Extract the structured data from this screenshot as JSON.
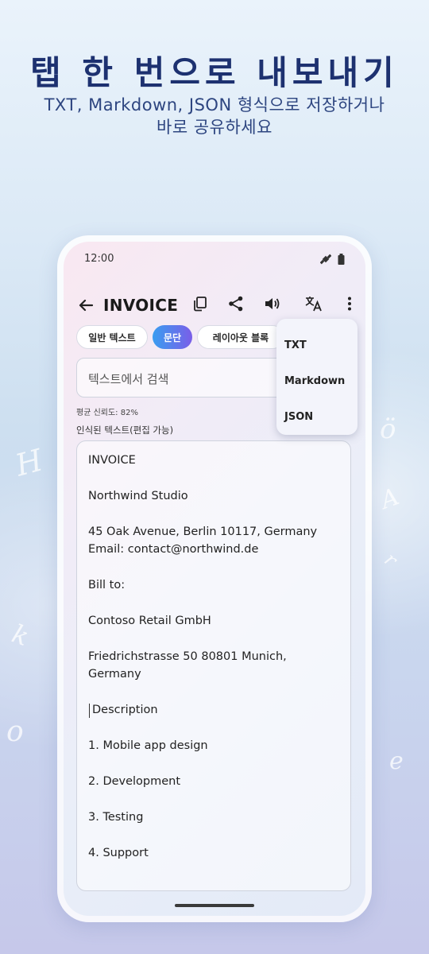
{
  "promo": {
    "headline": "탭 한 번으로 내보내기",
    "subline_1": "TXT, Markdown, JSON 형식으로 저장하거나",
    "subline_2": "바로 공유하세요"
  },
  "status_bar": {
    "time": "12:00",
    "icons": [
      "satellite-icon",
      "battery-icon"
    ]
  },
  "app_bar": {
    "back_icon": "arrow-left-icon",
    "title": "INVOICE",
    "actions": [
      "copy-icon",
      "share-icon",
      "volume-icon",
      "translate-icon",
      "more-vert-icon"
    ]
  },
  "chips": [
    {
      "label": "일반 텍스트",
      "active": false
    },
    {
      "label": "문단",
      "active": true
    },
    {
      "label": "레이아웃 블록",
      "active": false
    }
  ],
  "search": {
    "placeholder": "텍스트에서 검색"
  },
  "confidence": "평균 신뢰도: 82%",
  "section_label": "인식된 텍스트(편집 가능)",
  "recognized_text": [
    "INVOICE",
    "Northwind Studio",
    "45 Oak Avenue, Berlin 10117, Germany",
    "Email: contact@northwind.de",
    "Bill to:",
    "Contoso Retail GmbH",
    "Friedrichstrasse 50 80801 Munich,",
    "Germany",
    "Description",
    "1. Mobile app design",
    "2. Development",
    "3. Testing",
    "4. Support"
  ],
  "export_menu": {
    "items": [
      "TXT",
      "Markdown",
      "JSON"
    ]
  },
  "colors": {
    "headline": "#1d3170",
    "chip_active_start": "#3a9df0",
    "chip_active_end": "#7a5ee8"
  }
}
